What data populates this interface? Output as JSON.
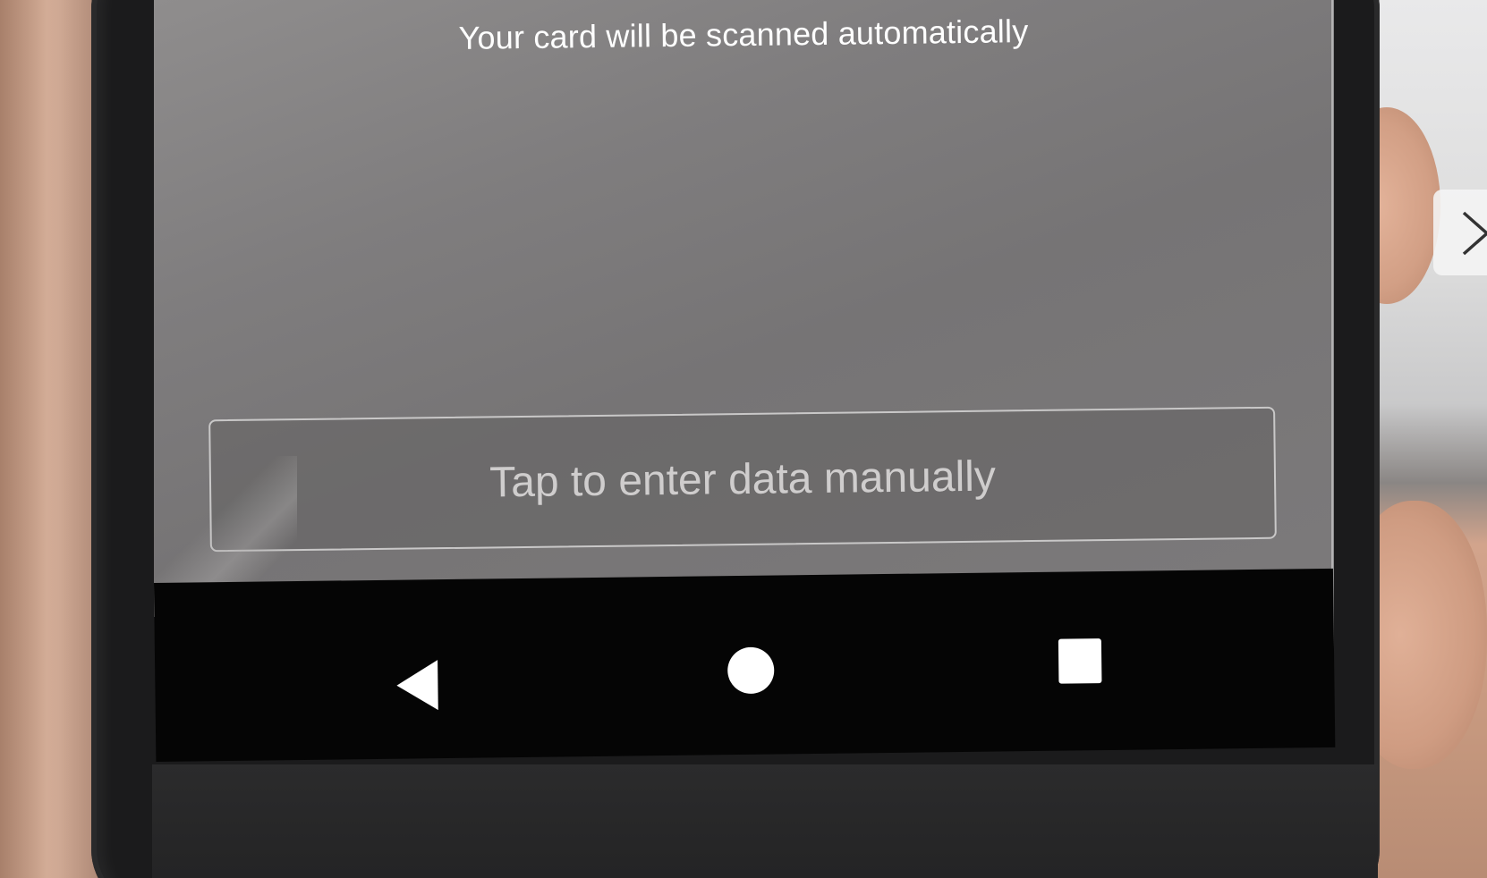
{
  "scan_screen": {
    "hint": "Your card will be scanned automatically",
    "manual_entry_label": "Tap to enter data manually"
  },
  "navigation_bar": {
    "buttons": [
      "back-icon",
      "home-icon",
      "recents-icon"
    ]
  },
  "overlay": {
    "next_control": "chevron-right-icon"
  },
  "colors": {
    "screen_bg": "#7f7d7e",
    "navbar_bg": "#050505",
    "text": "#ffffff"
  }
}
